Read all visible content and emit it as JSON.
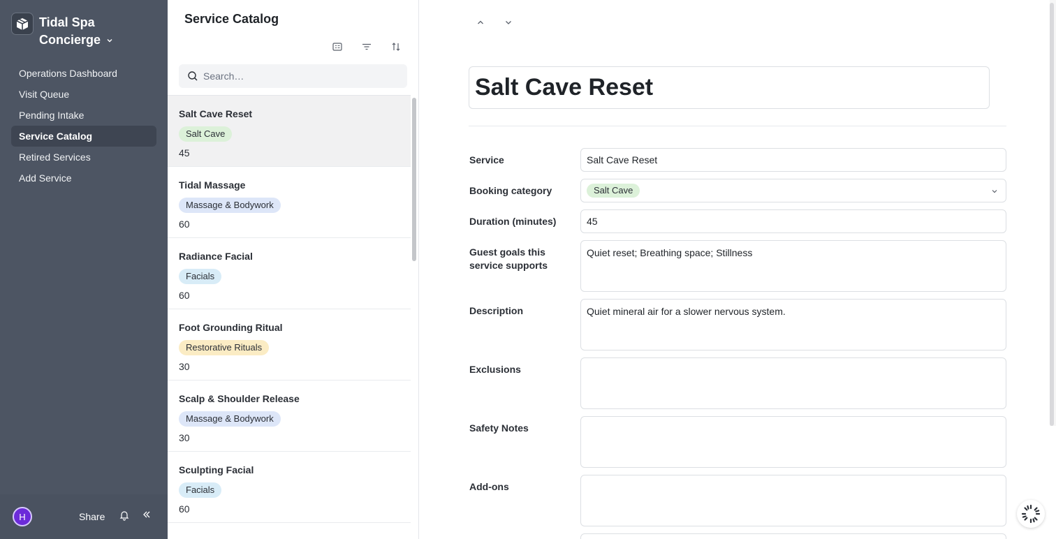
{
  "app": {
    "name_line1": "Tidal Spa",
    "name_line2": "Concierge"
  },
  "sidebar": {
    "items": [
      {
        "label": "Operations Dashboard",
        "active": false
      },
      {
        "label": "Visit Queue",
        "active": false
      },
      {
        "label": "Pending Intake",
        "active": false
      },
      {
        "label": "Service Catalog",
        "active": true
      },
      {
        "label": "Retired Services",
        "active": false
      },
      {
        "label": "Add Service",
        "active": false
      }
    ],
    "footer": {
      "avatar_initial": "H",
      "share_label": "Share"
    }
  },
  "list": {
    "title": "Service Catalog",
    "search_placeholder": "Search…",
    "items": [
      {
        "name": "Salt Cave Reset",
        "category": "Salt Cave",
        "category_color": "#dcf1d9",
        "duration": "45",
        "selected": true
      },
      {
        "name": "Tidal Massage",
        "category": "Massage & Bodywork",
        "category_color": "#dde6f8",
        "duration": "60",
        "selected": false
      },
      {
        "name": "Radiance Facial",
        "category": "Facials",
        "category_color": "#d8ecf7",
        "duration": "60",
        "selected": false
      },
      {
        "name": "Foot Grounding Ritual",
        "category": "Restorative Rituals",
        "category_color": "#fbecc4",
        "duration": "30",
        "selected": false
      },
      {
        "name": "Scalp & Shoulder Release",
        "category": "Massage & Bodywork",
        "category_color": "#dde6f8",
        "duration": "30",
        "selected": false
      },
      {
        "name": "Sculpting Facial",
        "category": "Facials",
        "category_color": "#d8ecf7",
        "duration": "60",
        "selected": false
      }
    ]
  },
  "detail": {
    "title": "Salt Cave Reset",
    "fields": {
      "service": {
        "label": "Service",
        "value": "Salt Cave Reset"
      },
      "booking_category": {
        "label": "Booking category",
        "value": "Salt Cave",
        "color": "#dcf1d9"
      },
      "duration": {
        "label": "Duration (minutes)",
        "value": "45"
      },
      "guest_goals": {
        "label": "Guest goals this service supports",
        "value": "Quiet reset; Breathing space; Stillness"
      },
      "description": {
        "label": "Description",
        "value": "Quiet mineral air for a slower nervous system."
      },
      "exclusions": {
        "label": "Exclusions",
        "value": ""
      },
      "safety_notes": {
        "label": "Safety Notes",
        "value": ""
      },
      "add_ons": {
        "label": "Add-ons",
        "value": ""
      }
    }
  }
}
